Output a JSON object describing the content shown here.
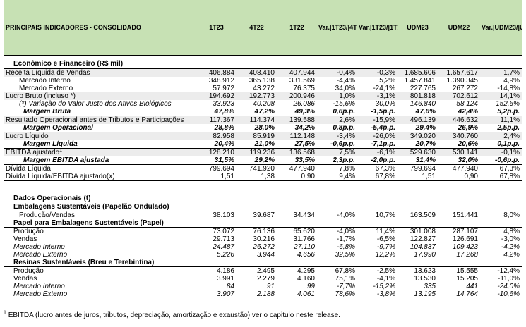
{
  "header": {
    "title": "PRINCIPAIS INDICADORES - CONSOLIDADO",
    "cols": [
      "1T23",
      "4T22",
      "1T22",
      "Var.|1T23/|4T22",
      "Var.|1T23/|1T22",
      "UDM23",
      "UDM22",
      "Var.|UDM23/|UDM22"
    ]
  },
  "econ": {
    "title": "Econômico e Financeiro (R$ mil)",
    "rows": [
      {
        "label": "Receita Líquida de Vendas",
        "v": [
          "406.884",
          "408.410",
          "407.944",
          "-0,4%",
          "-0,3%",
          "1.685.606",
          "1.657.617",
          "1,7%"
        ],
        "style": "",
        "ind": "",
        "band": true
      },
      {
        "label": "Mercado Interno",
        "v": [
          "348.912",
          "365.138",
          "331.569",
          "-4,4%",
          "5,2%",
          "1.457.841",
          "1.390.345",
          "4,9%"
        ],
        "style": "",
        "ind": "ind2",
        "band": false
      },
      {
        "label": "Mercado Externo",
        "v": [
          "57.972",
          "43.272",
          "76.375",
          "34,0%",
          "-24,1%",
          "227.765",
          "267.272",
          "-14,8%"
        ],
        "style": "",
        "ind": "ind2",
        "band": false
      },
      {
        "label": "Lucro Bruto (incluso *)",
        "v": [
          "194.692",
          "192.773",
          "200.946",
          "1,0%",
          "-3,1%",
          "801.818",
          "702.612",
          "14,1%"
        ],
        "style": "",
        "ind": "",
        "band": true
      },
      {
        "label": "(*) Variação do Valor Justo dos Ativos Biológicos",
        "v": [
          "33.923",
          "40.208",
          "26.086",
          "-15,6%",
          "30,0%",
          "146.840",
          "58.124",
          "152,6%"
        ],
        "style": "it",
        "ind": "ind2",
        "band": false
      },
      {
        "label": "Margem Bruta",
        "v": [
          "47,8%",
          "47,2%",
          "49,3%",
          "0,6p.p.",
          "-1,5p.p.",
          "47,6%",
          "42,4%",
          "5,2p.p."
        ],
        "style": "b it bb",
        "ind": "ind3",
        "band": false
      },
      {
        "label": "Resultado Operacional antes de Tributos e Participações",
        "v": [
          "117.367",
          "114.374",
          "139.588",
          "2,6%",
          "-15,9%",
          "496.139",
          "446.632",
          "11,1%"
        ],
        "style": "",
        "ind": "",
        "band": true
      },
      {
        "label": "Margem Operacional",
        "v": [
          "28,8%",
          "28,0%",
          "34,2%",
          "0,8p.p.",
          "-5,4p.p.",
          "29,4%",
          "26,9%",
          "2,5p.p."
        ],
        "style": "b it bb",
        "ind": "ind3",
        "band": false
      },
      {
        "label": "Lucro Líquido",
        "v": [
          "82.958",
          "85.919",
          "112.148",
          "-3,4%",
          "-26,0%",
          "349.020",
          "340.760",
          "2,4%"
        ],
        "style": "",
        "ind": "",
        "band": true
      },
      {
        "label": "Margem Líquida",
        "v": [
          "20,4%",
          "21,0%",
          "27,5%",
          "-0,6p.p.",
          "-7,1p.p.",
          "20,7%",
          "20,6%",
          "0,1p.p."
        ],
        "style": "b it bb",
        "ind": "ind3",
        "band": false
      },
      {
        "label": "EBITDA ajustado",
        "sup": "1",
        "v": [
          "128.210",
          "119.236",
          "136.568",
          "7,5%",
          "-6,1%",
          "529.630",
          "530.141",
          "-0,1%"
        ],
        "style": "",
        "ind": "",
        "band": true
      },
      {
        "label": "Margem EBITDA ajustada",
        "v": [
          "31,5%",
          "29,2%",
          "33,5%",
          "2,3p.p.",
          "-2,0p.p.",
          "31,4%",
          "32,0%",
          "-0,6p.p."
        ],
        "style": "b it bb",
        "ind": "ind3",
        "band": false
      },
      {
        "label": "Dívida Líquida",
        "v": [
          "799.694",
          "741.920",
          "477.940",
          "7,8%",
          "67,3%",
          "799.694",
          "477.940",
          "67,3%"
        ],
        "style": "",
        "ind": "",
        "band": false
      },
      {
        "label": "Dívida Líquida/EBITDA ajustado(x)",
        "v": [
          "1,51",
          "1,38",
          "0,90",
          "9,4%",
          "67,8%",
          "1,51",
          "0,90",
          "67,8%"
        ],
        "style": "bb",
        "ind": "",
        "band": false
      }
    ]
  },
  "ops": {
    "title": "Dados Operacionais (t)",
    "groups": [
      {
        "title": "Embalagens Sustentáveis  (Papelão Ondulado)",
        "rows": [
          {
            "label": "Produção/Vendas",
            "v": [
              "38.103",
              "39.687",
              "34.434",
              "-4,0%",
              "10,7%",
              "163.509",
              "151.441",
              "8,0%"
            ],
            "style": "",
            "ind": "ind2"
          }
        ]
      },
      {
        "title": "Papel para Embalagens Sustentáveis (Papel)",
        "rows": [
          {
            "label": "Produção",
            "v": [
              "73.072",
              "76.136",
              "65.620",
              "-4,0%",
              "11,4%",
              "301.008",
              "287.107",
              "4,8%"
            ],
            "style": "",
            "ind": "ind1"
          },
          {
            "label": "Vendas",
            "v": [
              "29.713",
              "30.216",
              "31.766",
              "-1,7%",
              "-6,5%",
              "122.827",
              "126.691",
              "-3,0%"
            ],
            "style": "",
            "ind": "ind1"
          },
          {
            "label": "Mercado Interno",
            "v": [
              "24.487",
              "26.272",
              "27.110",
              "-6,8%",
              "-9,7%",
              "104.837",
              "109.423",
              "-4,2%"
            ],
            "style": "it",
            "ind": "ind1"
          },
          {
            "label": "Mercado Externo",
            "v": [
              "5.226",
              "3.944",
              "4.656",
              "32,5%",
              "12,2%",
              "17.990",
              "17.268",
              "4,2%"
            ],
            "style": "it",
            "ind": "ind1"
          }
        ]
      },
      {
        "title": "Resinas Sustentáveis (Breu e Terebintina)",
        "rows": [
          {
            "label": "Produção",
            "v": [
              "4.186",
              "2.495",
              "4.295",
              "67,8%",
              "-2,5%",
              "13.623",
              "15.555",
              "-12,4%"
            ],
            "style": "",
            "ind": "ind1"
          },
          {
            "label": "Vendas",
            "v": [
              "3.991",
              "2.279",
              "4.160",
              "75,1%",
              "-4,1%",
              "13.530",
              "15.205",
              "-11,0%"
            ],
            "style": "",
            "ind": "ind1"
          },
          {
            "label": "Mercado Interno",
            "v": [
              "84",
              "91",
              "99",
              "-7,7%",
              "-15,2%",
              "335",
              "441",
              "-24,0%"
            ],
            "style": "it",
            "ind": "ind1"
          },
          {
            "label": "Mercado Externo",
            "v": [
              "3.907",
              "2.188",
              "4.061",
              "78,6%",
              "-3,8%",
              "13.195",
              "14.764",
              "-10,6%"
            ],
            "style": "it",
            "ind": "ind1"
          }
        ]
      }
    ]
  },
  "footnote": {
    "sup": "1",
    "text": "EBITDA (lucro antes de juros, tributos, depreciação, amortização e exaustão) ver o capitulo neste release."
  }
}
